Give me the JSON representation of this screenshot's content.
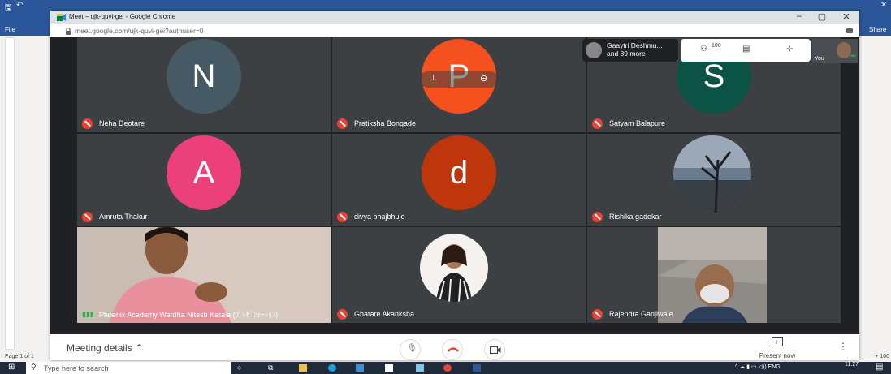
{
  "word": {
    "file_tab": "File",
    "share_label": "Share",
    "status": "Page 1 of 1",
    "zoom": "+ 100"
  },
  "chrome": {
    "tab_title": "Meet – ujk-quvi-gei - Google Chrome",
    "url": "meet.google.com/ujk-quvi-gei?authuser=0"
  },
  "meet": {
    "people_chip": {
      "line1": "Gaaytri Deshmu...",
      "line2": "and 89 more"
    },
    "participants_count": "100",
    "self_label": "You",
    "tiles": [
      {
        "name": "Neha Deotare",
        "initial": "N",
        "color": "#455a64"
      },
      {
        "name": "Pratiksha Bongade",
        "initial": "P",
        "color": "#f4511e"
      },
      {
        "name": "Satyam Balapure",
        "initial": "S",
        "color": "#0b5345"
      },
      {
        "name": "Amruta Thakur",
        "initial": "A",
        "color": "#ec407a"
      },
      {
        "name": "divya bhajbhuje",
        "initial": "d",
        "color": "#bf360c"
      },
      {
        "name": "Rishika gadekar",
        "initial": "",
        "color": "#37474f"
      },
      {
        "name": "Phoenix Academy Wardha Nitesh Karale (ﾌﾟﾚｾﾞﾝﾃｰｼｮﾝ)",
        "initial": "",
        "color": "#8a7a6a"
      },
      {
        "name": "Ghatare Akanksha",
        "initial": "",
        "color": "#3c4043"
      },
      {
        "name": "Rajendra Ganjiwale",
        "initial": "",
        "color": "#6d6a66"
      }
    ],
    "bottom": {
      "meeting_details": "Meeting details",
      "present_now": "Present now"
    }
  },
  "taskbar": {
    "search_placeholder": "Type here to search",
    "lang": "ENG",
    "time": "11:27"
  }
}
